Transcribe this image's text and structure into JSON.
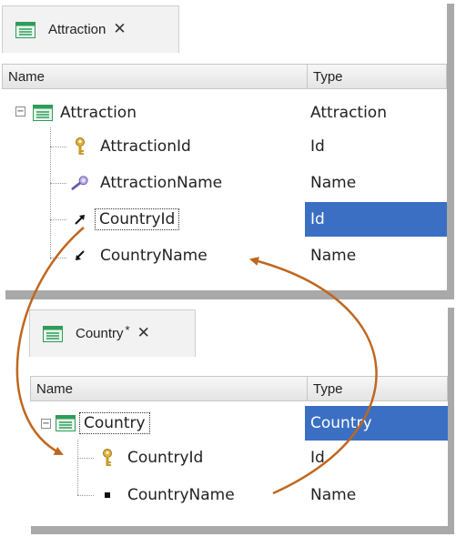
{
  "panel1": {
    "tab_title": "Attraction",
    "close_glyph": "✕",
    "headers": {
      "name": "Name",
      "type": "Type"
    },
    "root": {
      "name": "Attraction",
      "type": "Attraction"
    },
    "rows": [
      {
        "name": "AttractionId",
        "type": "Id",
        "icon": "key-icon"
      },
      {
        "name": "AttractionName",
        "type": "Name",
        "icon": "description-icon"
      },
      {
        "name": "CountryId",
        "type": "Id",
        "icon": "foreign-key-icon",
        "selected": true
      },
      {
        "name": "CountryName",
        "type": "Name",
        "icon": "inferred-attribute-icon"
      }
    ]
  },
  "panel2": {
    "tab_title": "Country",
    "dirty_marker": "*",
    "close_glyph": "✕",
    "headers": {
      "name": "Name",
      "type": "Type"
    },
    "root": {
      "name": "Country",
      "type": "Country",
      "selected": true
    },
    "rows": [
      {
        "name": "CountryId",
        "type": "Id",
        "icon": "key-icon"
      },
      {
        "name": "CountryName",
        "type": "Name",
        "icon": "bullet-icon"
      }
    ]
  },
  "colors": {
    "selection": "#3a6fc4",
    "arrow": "#c0661e",
    "tab_icon": "#2e9c5a"
  }
}
